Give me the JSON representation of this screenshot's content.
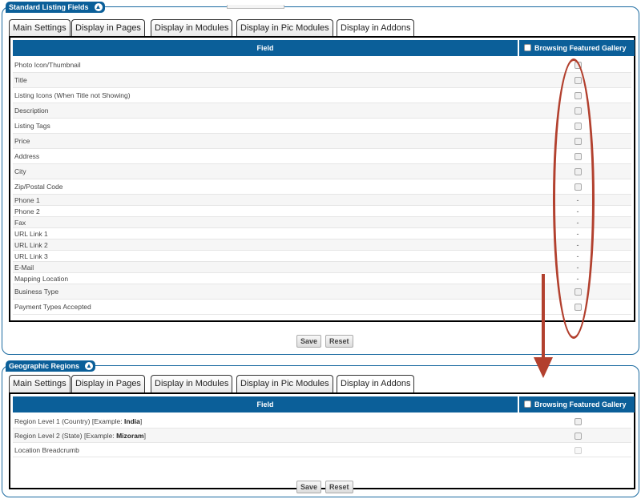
{
  "sections": [
    {
      "title": "Standard Listing Fields",
      "tabs": [
        "Main Settings",
        "Display in Pages",
        "Display in Modules",
        "Display in Pic Modules",
        "Display in Addons"
      ],
      "active_tab": "Display in Addons",
      "header_field": "Field",
      "header_gallery": "Browsing Featured Gallery",
      "rows": [
        {
          "label": "Photo Icon/Thumbnail",
          "cell": "checkbox"
        },
        {
          "label": "Title",
          "cell": "checkbox"
        },
        {
          "label": "Listing Icons (When Title not Showing)",
          "cell": "checkbox"
        },
        {
          "label": "Description",
          "cell": "checkbox"
        },
        {
          "label": "Listing Tags",
          "cell": "checkbox"
        },
        {
          "label": "Price",
          "cell": "checkbox"
        },
        {
          "label": "Address",
          "cell": "checkbox"
        },
        {
          "label": "City",
          "cell": "checkbox"
        },
        {
          "label": "Zip/Postal Code",
          "cell": "checkbox"
        },
        {
          "label": "Phone 1",
          "cell": "-"
        },
        {
          "label": "Phone 2",
          "cell": "-"
        },
        {
          "label": "Fax",
          "cell": "-"
        },
        {
          "label": "URL Link 1",
          "cell": "-"
        },
        {
          "label": "URL Link 2",
          "cell": "-"
        },
        {
          "label": "URL Link 3",
          "cell": "-"
        },
        {
          "label": "E-Mail",
          "cell": "-"
        },
        {
          "label": "Mapping Location",
          "cell": "-"
        },
        {
          "label": "Business Type",
          "cell": "checkbox"
        },
        {
          "label": "Payment Types Accepted",
          "cell": "checkbox"
        }
      ],
      "save_label": "Save",
      "reset_label": "Reset"
    },
    {
      "title": "Geographic Regions",
      "tabs": [
        "Main Settings",
        "Display in Pages",
        "Display in Modules",
        "Display in Pic Modules",
        "Display in Addons"
      ],
      "active_tab": "Display in Addons",
      "header_field": "Field",
      "header_gallery": "Browsing Featured Gallery",
      "rows": [
        {
          "label": "Region Level 1 (Country) [Example: ",
          "bold": "India",
          "suffix": "]",
          "cell": "checkbox"
        },
        {
          "label": "Region Level 2 (State) [Example: ",
          "bold": "Mizoram",
          "suffix": "]",
          "cell": "checkbox"
        },
        {
          "label": "Location Breadcrumb",
          "cell": "checkbox-disabled"
        }
      ],
      "save_label": "Save",
      "reset_label": "Reset"
    }
  ],
  "colors": {
    "header_bg": "#0b5f99",
    "annotation": "#b2402e"
  },
  "icons": {
    "collapse": "chevron-up-icon"
  }
}
